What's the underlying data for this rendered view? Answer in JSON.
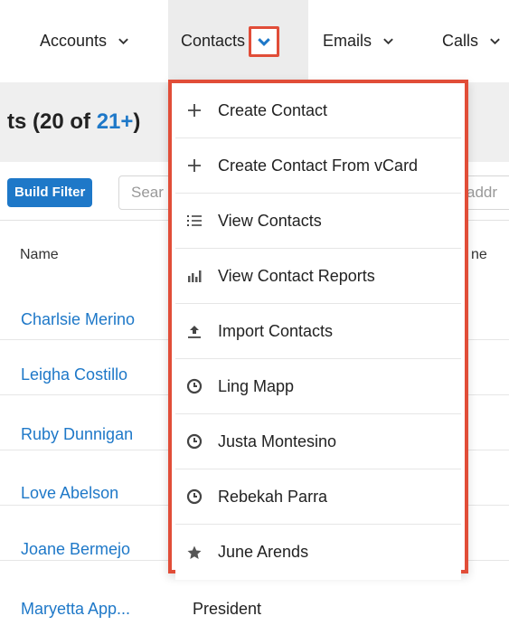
{
  "nav": {
    "tabs": [
      {
        "label": "Accounts"
      },
      {
        "label": "Contacts"
      },
      {
        "label": "Emails"
      },
      {
        "label": "Calls"
      }
    ]
  },
  "header": {
    "title_prefix": "ts (20 of ",
    "title_count": "21+",
    "title_suffix": ")"
  },
  "filter": {
    "build_filter_label": "Build Filter",
    "search_placeholder": "Sear",
    "search_suffix": "addr"
  },
  "table": {
    "columns": [
      "Name",
      "ne"
    ],
    "rows": [
      {
        "name": "Charlsie Merino",
        "title": ""
      },
      {
        "name": "Leigha Costillo",
        "title": ""
      },
      {
        "name": "Ruby Dunnigan",
        "title": ""
      },
      {
        "name": "Love Abelson",
        "title": ""
      },
      {
        "name": "Joane Bermejo",
        "title": ""
      },
      {
        "name": "Maryetta App...",
        "title": "President"
      }
    ]
  },
  "dropdown": {
    "items": [
      {
        "label": "Create Contact",
        "icon": "plus-icon"
      },
      {
        "label": "Create Contact From vCard",
        "icon": "plus-icon"
      },
      {
        "label": "View Contacts",
        "icon": "list-icon"
      },
      {
        "label": "View Contact Reports",
        "icon": "bar-chart-icon"
      },
      {
        "label": "Import Contacts",
        "icon": "upload-icon"
      },
      {
        "label": "Ling Mapp",
        "icon": "recent-clock-icon"
      },
      {
        "label": "Justa Montesino",
        "icon": "recent-clock-icon"
      },
      {
        "label": "Rebekah Parra",
        "icon": "recent-clock-icon"
      },
      {
        "label": "June Arends",
        "icon": "star-icon"
      }
    ]
  },
  "colors": {
    "accent": "#1e78c8",
    "highlight_border": "#e14d38"
  }
}
